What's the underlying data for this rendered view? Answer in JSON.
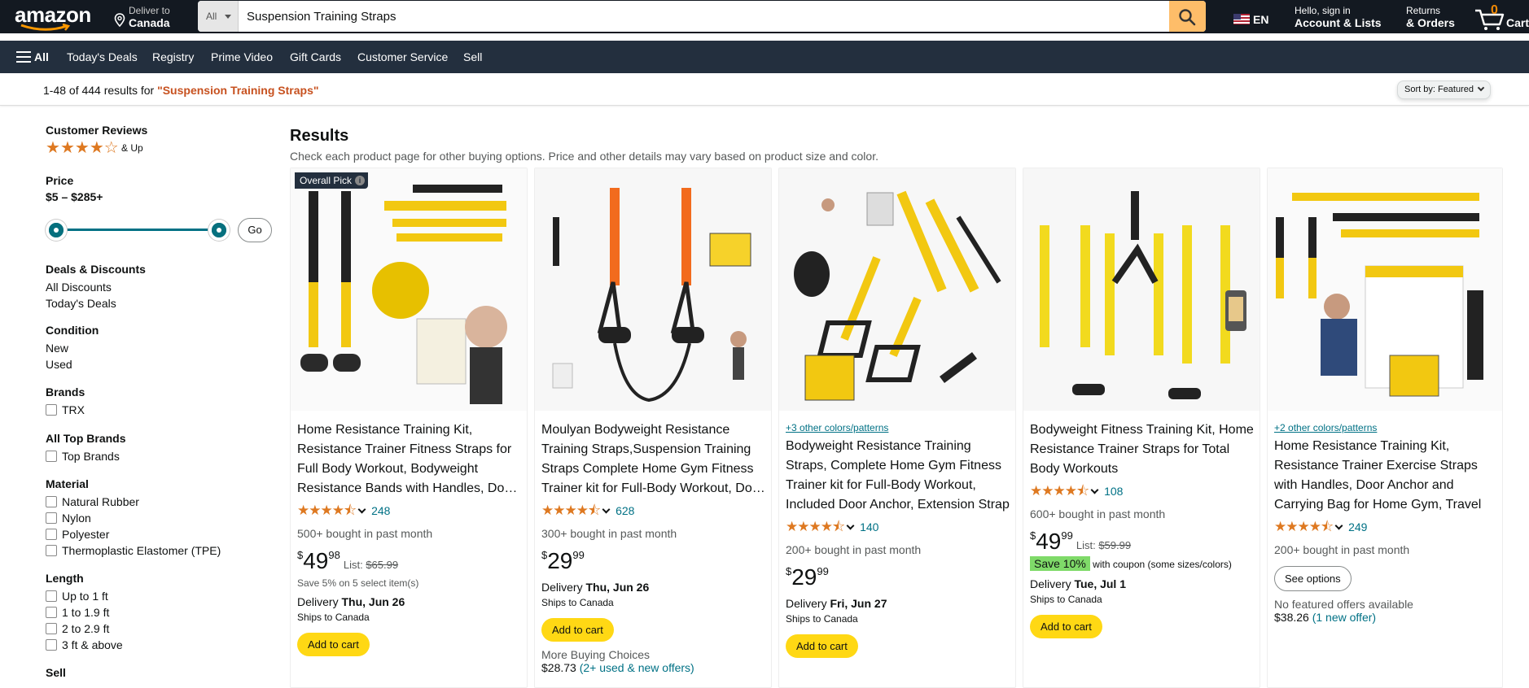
{
  "header": {
    "logo_text": "amazon",
    "deliver_line1": "Deliver to",
    "deliver_line2": "Canada",
    "search_category": "All",
    "search_value": "Suspension Training Straps",
    "language": "EN",
    "account_line1": "Hello, sign in",
    "account_line2": "Account & Lists",
    "orders_line1": "Returns",
    "orders_line2": "& Orders",
    "cart_count": "0",
    "cart_label": "Cart",
    "icons": {
      "pin": "location-pin-icon",
      "search": "search-icon",
      "cart": "cart-icon",
      "flag": "us-flag-icon",
      "menu": "hamburger-icon"
    },
    "colors": {
      "nav_bg": "#131921",
      "subnav_bg": "#232F3E",
      "search_btn": "#FEBD69",
      "cart_count": "#F08804"
    }
  },
  "subnav": {
    "all": "All",
    "items": [
      "Today's Deals",
      "Registry",
      "Prime Video",
      "Gift Cards",
      "Customer Service",
      "Sell"
    ]
  },
  "results_bar": {
    "count_text": "1-48 of 444 results for ",
    "query": "\"Suspension Training Straps\"",
    "sort_label": "Sort by:",
    "sort_value": "Featured"
  },
  "sidebar": {
    "reviews": {
      "heading": "Customer Reviews",
      "stars": 4,
      "suffix": "& Up"
    },
    "price": {
      "heading": "Price",
      "range": "$5 – $285+",
      "go": "Go"
    },
    "deals": {
      "heading": "Deals & Discounts",
      "items": [
        "All Discounts",
        "Today's Deals"
      ]
    },
    "condition": {
      "heading": "Condition",
      "items": [
        "New",
        "Used"
      ]
    },
    "brands": {
      "heading": "Brands",
      "items": [
        "TRX"
      ]
    },
    "top_brands": {
      "heading": "All Top Brands",
      "items": [
        "Top Brands"
      ]
    },
    "material": {
      "heading": "Material",
      "items": [
        "Natural Rubber",
        "Nylon",
        "Polyester",
        "Thermoplastic Elastomer (TPE)"
      ]
    },
    "length": {
      "heading": "Length",
      "items": [
        "Up to 1 ft",
        "1 to 1.9 ft",
        "2 to 2.9 ft",
        "3 ft & above"
      ]
    },
    "next_heading": "Sell"
  },
  "main": {
    "heading": "Results",
    "subheading": "Check each product page for other buying options. Price and other details may vary based on product size and color."
  },
  "products": [
    {
      "badge": "Overall Pick",
      "title": "Home Resistance Training Kit, Resistance Trainer Fitness Straps for Full Body Workout, Bodyweight Resistance Bands with Handles, Door Anchor",
      "stars": "★★★★⯪",
      "rating": 4.5,
      "reviews": "248",
      "bought": "500+ bought in past month",
      "price_whole": "49",
      "price_frac": "98",
      "list_label": "List:",
      "list_price": "$65.99",
      "save_note": "Save 5% on 5 select item(s)",
      "delivery_label": "Delivery ",
      "delivery_date": "Thu, Jun 26",
      "ships": "Ships to Canada",
      "action": "Add to cart",
      "image_colors": "yellow/black"
    },
    {
      "title": "Moulyan Bodyweight Resistance Training Straps,Suspension Training Straps Complete Home Gym Fitness Trainer kit for Full-Body Workout, Door Anchor",
      "stars": "★★★★⯪",
      "rating": 4.5,
      "reviews": "628",
      "bought": "300+ bought in past month",
      "price_whole": "29",
      "price_frac": "99",
      "delivery_label": "Delivery ",
      "delivery_date": "Thu, Jun 26",
      "ships": "Ships to Canada",
      "action": "Add to cart",
      "more": "More Buying Choices",
      "more_price": "$28.73",
      "more_link": "(2+ used & new offers)",
      "image_colors": "orange/black"
    },
    {
      "colors_link": "+3 other colors/patterns",
      "title": "Bodyweight Resistance Training Straps, Complete Home Gym Fitness Trainer kit for Full-Body Workout, Included Door Anchor, Extension Strap",
      "stars": "★★★★⯪",
      "rating": 4.5,
      "reviews": "140",
      "bought": "200+ bought in past month",
      "price_whole": "29",
      "price_frac": "99",
      "delivery_label": "Delivery ",
      "delivery_date": "Fri, Jun 27",
      "ships": "Ships to Canada",
      "action": "Add to cart",
      "image_colors": "yellow/black"
    },
    {
      "title": "Bodyweight Fitness Training Kit, Home Resistance Trainer Straps for Total Body Workouts",
      "stars": "★★★★⯪",
      "rating": 4.5,
      "reviews": "108",
      "bought": "600+ bought in past month",
      "price_whole": "49",
      "price_frac": "99",
      "list_label": "List:",
      "list_price": "$59.99",
      "coupon": "Save 10%",
      "coupon_note": " with coupon (some sizes/colors)",
      "delivery_label": "Delivery ",
      "delivery_date": "Tue, Jul 1",
      "ships": "Ships to Canada",
      "action": "Add to cart",
      "image_colors": "yellow/black"
    },
    {
      "colors_link": "+2 other colors/patterns",
      "title": "Home Resistance Training Kit, Resistance Trainer Exercise Straps with Handles, Door Anchor and Carrying Bag for Home Gym, Travel",
      "stars": "★★★★⯪",
      "rating": 4.5,
      "reviews": "249",
      "bought": "200+ bought in past month",
      "action": "See options",
      "no_offers": "No featured offers available",
      "offer_price": "$38.26",
      "offer_link": "(1 new offer)",
      "image_colors": "yellow/black"
    }
  ]
}
